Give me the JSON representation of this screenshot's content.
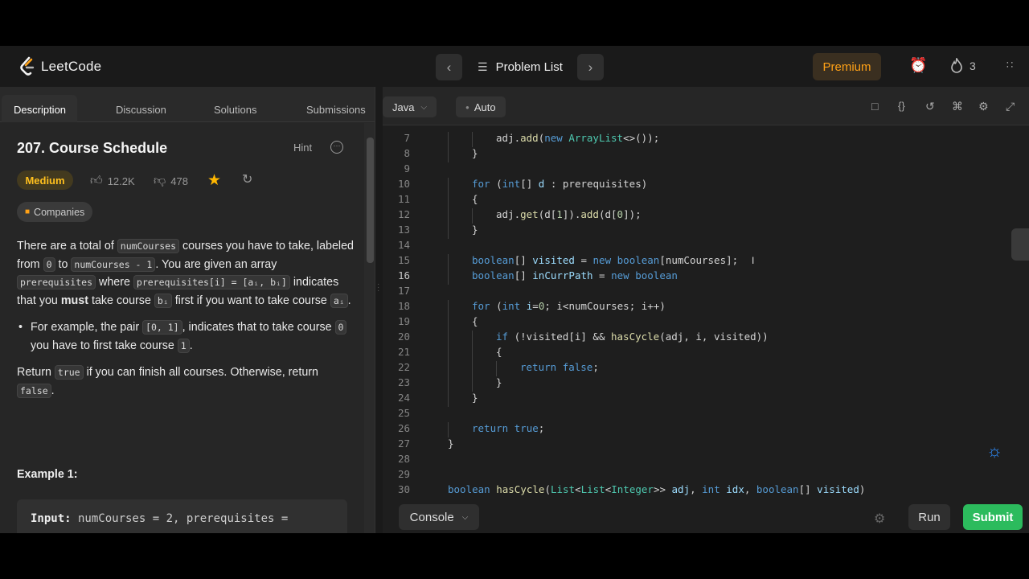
{
  "nav": {
    "logo_text": "LeetCode",
    "problem_list": "Problem List",
    "premium": "Premium",
    "streak_count": "3"
  },
  "tabs": [
    "Description",
    "Discussion",
    "Solutions",
    "Submissions"
  ],
  "problem": {
    "title": "207. Course Schedule",
    "hint": "Hint",
    "difficulty": "Medium",
    "likes": "12.2K",
    "dislikes": "478",
    "companies": "Companies",
    "p1_a": "There are a total of ",
    "p1_code1": "numCourses",
    "p1_b": " courses you have to take, labeled from ",
    "p1_code2": "0",
    "p1_c": " to ",
    "p1_code3": "numCourses - 1",
    "p1_d": ". You are given an array ",
    "p1_code4": "prerequisites",
    "p1_e": " where ",
    "p1_code5": "prerequisites[i] = [aᵢ, bᵢ]",
    "p1_f": " indicates that you ",
    "p1_must": "must",
    "p1_g": " take course ",
    "p1_code6": "bᵢ",
    "p1_h": " first if you want to take course ",
    "p1_code7": "aᵢ",
    "p1_i": ".",
    "b1_a": "For example, the pair ",
    "b1_code1": "[0, 1]",
    "b1_b": ", indicates that to take course ",
    "b1_code2": "0",
    "b1_c": " you have to first take course ",
    "b1_code3": "1",
    "b1_d": ".",
    "p2_a": "Return ",
    "p2_code1": "true",
    "p2_b": " if you can finish all courses. Otherwise, return ",
    "p2_code2": "false",
    "p2_c": ".",
    "example_title": "Example 1:",
    "example_input_label": "Input:",
    "example_input": " numCourses = 2, prerequisites ="
  },
  "editor": {
    "language": "Java",
    "mode": "Auto",
    "current_line": "16",
    "lines": [
      {
        "n": "7",
        "indent": 2,
        "html": "adj.<span class='fn'>add</span>(<span class='kw'>new</span> <span class='ty'>ArrayList</span>&lt;&gt;());"
      },
      {
        "n": "8",
        "indent": 1,
        "html": "}"
      },
      {
        "n": "9",
        "indent": 0,
        "html": ""
      },
      {
        "n": "10",
        "indent": 1,
        "html": "<span class='kw'>for</span> (<span class='kw'>int</span>[] <span class='vr'>d</span> : prerequisites)"
      },
      {
        "n": "11",
        "indent": 1,
        "html": "{"
      },
      {
        "n": "12",
        "indent": 2,
        "html": "adj.<span class='fn'>get</span>(d[<span class='nm'>1</span>]).<span class='fn'>add</span>(d[<span class='nm'>0</span>]);"
      },
      {
        "n": "13",
        "indent": 1,
        "html": "}"
      },
      {
        "n": "14",
        "indent": 0,
        "html": ""
      },
      {
        "n": "15",
        "indent": 1,
        "html": "<span class='kw'>boolean</span>[] <span class='vr'>visited</span> = <span class='kw'>new</span> <span class='kw'>boolean</span>[numCourses];"
      },
      {
        "n": "16",
        "indent": 1,
        "html": "<span class='kw'>boolean</span>[] <span class='vr'>inCurrPath</span> = <span class='kw'>new</span> <span class='kw'>boolean</span>"
      },
      {
        "n": "17",
        "indent": 0,
        "html": ""
      },
      {
        "n": "18",
        "indent": 1,
        "html": "<span class='kw'>for</span> (<span class='kw'>int</span> <span class='vr'>i</span>=<span class='nm'>0</span>; i&lt;numCourses; i++)"
      },
      {
        "n": "19",
        "indent": 1,
        "html": "{"
      },
      {
        "n": "20",
        "indent": 2,
        "html": "<span class='kw'>if</span> (!visited[i] &amp;&amp; <span class='fn'>hasCycle</span>(adj, i, visited))"
      },
      {
        "n": "21",
        "indent": 2,
        "html": "{"
      },
      {
        "n": "22",
        "indent": 3,
        "html": "<span class='kw'>return</span> <span class='kw'>false</span>;"
      },
      {
        "n": "23",
        "indent": 2,
        "html": "}"
      },
      {
        "n": "24",
        "indent": 1,
        "html": "}"
      },
      {
        "n": "25",
        "indent": 0,
        "html": ""
      },
      {
        "n": "26",
        "indent": 1,
        "html": "<span class='kw'>return</span> <span class='kw'>true</span>;"
      },
      {
        "n": "27",
        "indent": 0,
        "html": "}"
      },
      {
        "n": "28",
        "indent": 0,
        "html": ""
      },
      {
        "n": "29",
        "indent": 0,
        "html": ""
      },
      {
        "n": "30",
        "indent": 0,
        "html": "<span class='kw'>boolean</span> <span class='fn'>hasCycle</span>(<span class='ty'>List</span>&lt;<span class='ty'>List</span>&lt;<span class='ty'>Integer</span>&gt;&gt; <span class='vr'>adj</span>, <span class='kw'>int</span> <span class='vr'>idx</span>, <span class='kw'>boolean</span>[] <span class='vr'>visited</span>)"
      }
    ]
  },
  "bottom": {
    "console": "Console",
    "run": "Run",
    "submit": "Submit"
  },
  "colors": {
    "accent_green": "#2cbb5d",
    "premium_orange": "#ffa116",
    "medium_yellow": "#ffc01e"
  }
}
